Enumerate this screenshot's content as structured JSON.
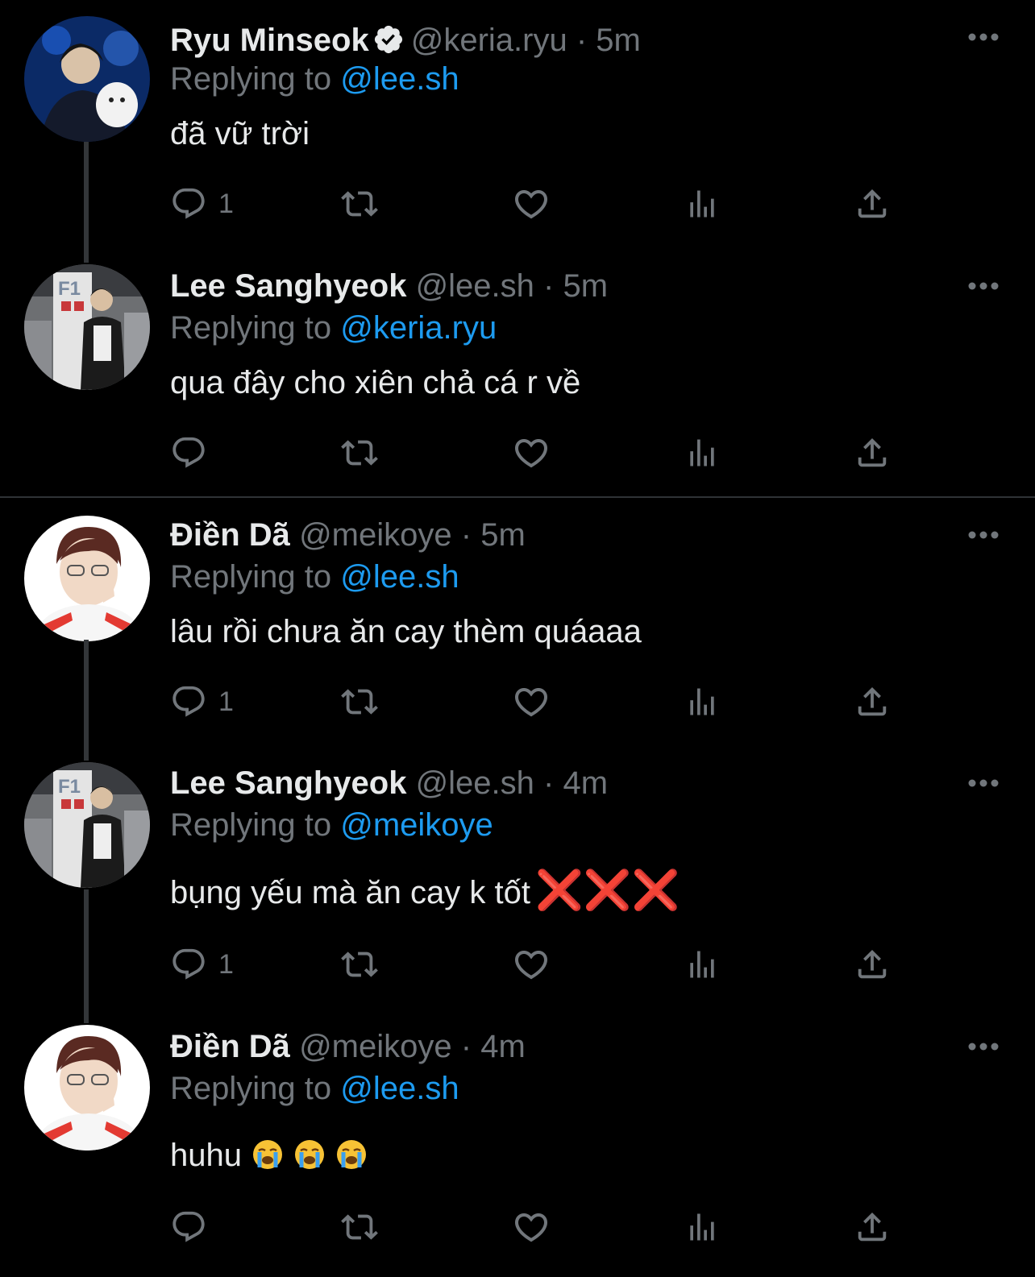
{
  "tweets": [
    {
      "name": "Ryu Minseok",
      "verified": true,
      "handle": "@keria.ryu",
      "dot": "·",
      "time": "5m",
      "replying_label": "Replying to",
      "mention": "@lee.sh",
      "text": "đã vữ trời",
      "reply_count": "1",
      "avatar": "keria-avatar"
    },
    {
      "name": "Lee Sanghyeok",
      "verified": false,
      "handle": "@lee.sh",
      "dot": "·",
      "time": "5m",
      "replying_label": "Replying to",
      "mention": "@keria.ryu",
      "text": "qua đây cho xiên chả cá r về",
      "reply_count": "",
      "avatar": "faker-avatar"
    },
    {
      "name": "Điền Dã",
      "verified": false,
      "handle": "@meikoye",
      "dot": "·",
      "time": "5m",
      "replying_label": "Replying to",
      "mention": "@lee.sh",
      "text": "lâu rồi chưa ăn cay thèm quáaaa",
      "reply_count": "1",
      "avatar": "meiko-avatar"
    },
    {
      "name": "Lee Sanghyeok",
      "verified": false,
      "handle": "@lee.sh",
      "dot": "·",
      "time": "4m",
      "replying_label": "Replying to",
      "mention": "@meikoye",
      "text": "bụng yếu mà ăn cay k tốt",
      "text_emoji": "❌❌❌",
      "reply_count": "1",
      "avatar": "faker-avatar"
    },
    {
      "name": "Điền Dã",
      "verified": false,
      "handle": "@meikoye",
      "dot": "·",
      "time": "4m",
      "replying_label": "Replying to",
      "mention": "@lee.sh",
      "text": "huhu",
      "text_emoji_names": [
        "loudly-crying-face",
        "loudly-crying-face",
        "loudly-crying-face"
      ],
      "reply_count": "",
      "avatar": "meiko-avatar"
    }
  ],
  "icons": {
    "reply": "reply-icon",
    "retweet": "retweet-icon",
    "like": "like-icon",
    "views": "views-icon",
    "share": "share-icon",
    "more": "more-icon",
    "verified": "verified-badge-icon"
  },
  "colors": {
    "background": "#000000",
    "text": "#e7e9ea",
    "muted": "#71767b",
    "link": "#1d9bf0",
    "divider": "#2f3336",
    "thread_line": "#333639"
  }
}
